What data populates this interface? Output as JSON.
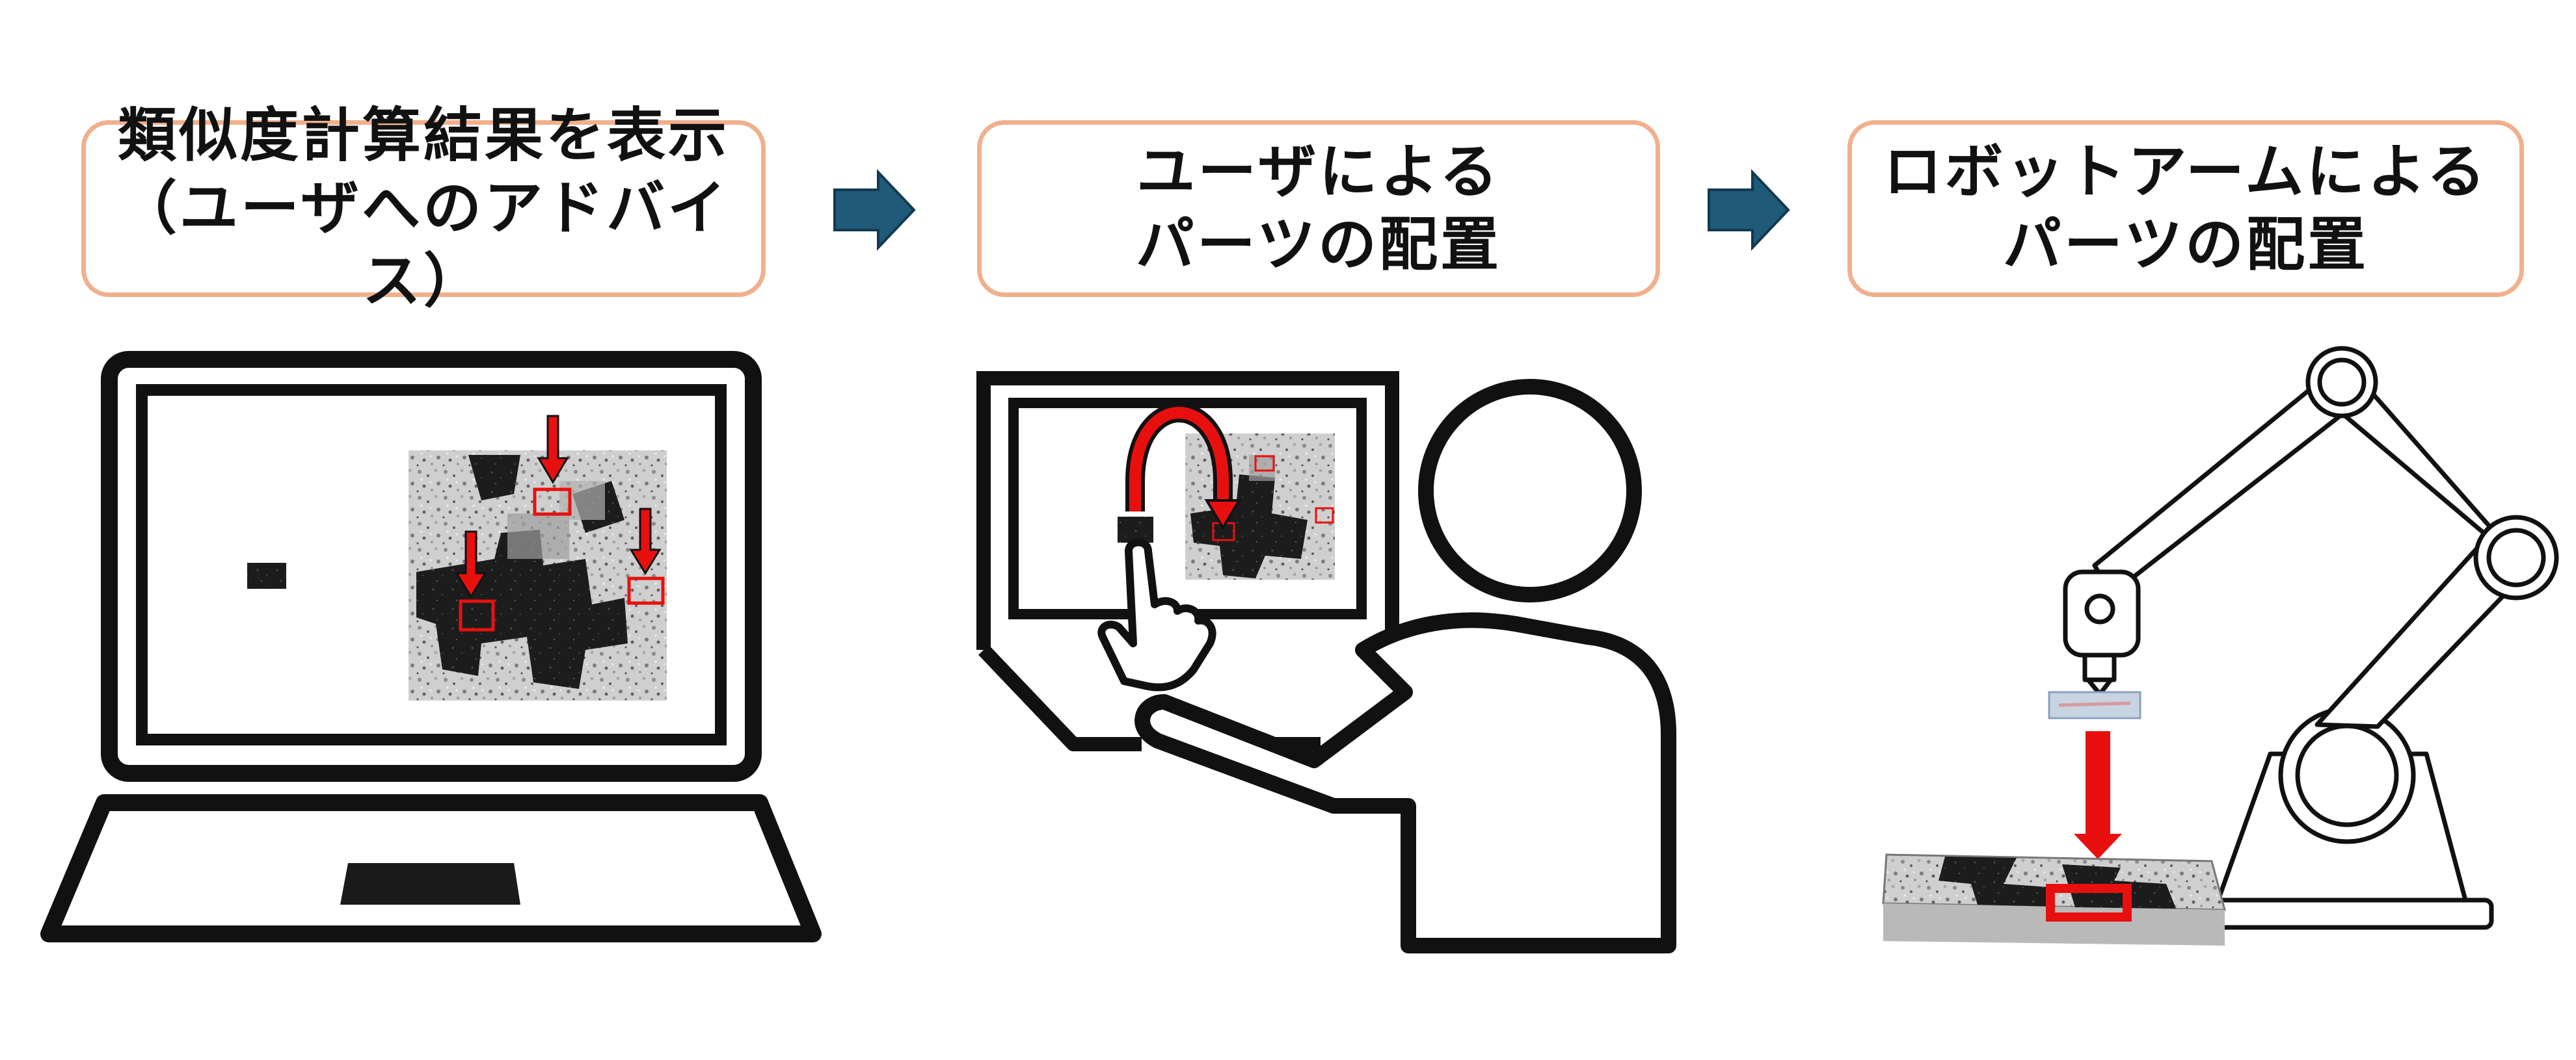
{
  "steps": [
    {
      "line1": "類似度計算結果を表示",
      "line2": "（ユーザへのアドバイス）"
    },
    {
      "line1": "ユーザによる",
      "line2": "パーツの配置"
    },
    {
      "line1": "ロボットアームによる",
      "line2": "パーツの配置"
    }
  ],
  "colors": {
    "box_border": "#f0b08e",
    "arrow_fill": "#1f5a78",
    "arrow_stroke": "#123a50",
    "highlight_red": "#e8100f",
    "line": "#111111"
  },
  "icons": [
    "laptop-icon",
    "user-at-monitor-icon",
    "robot-arm-icon",
    "stone-panel-icon"
  ]
}
